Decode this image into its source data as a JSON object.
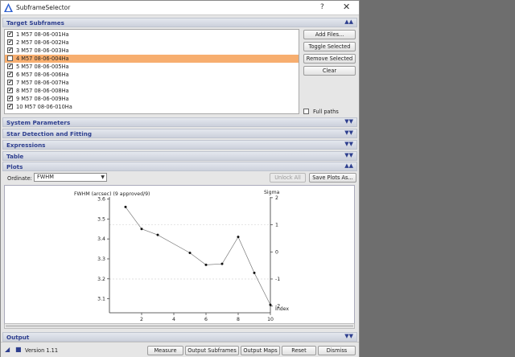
{
  "window": {
    "title": "SubframeSelector",
    "help": "?",
    "close": "✕"
  },
  "sections": {
    "target": "Target Subframes",
    "system": "System Parameters",
    "star": "Star Detection and Fitting",
    "expressions": "Expressions",
    "table": "Table",
    "plots": "Plots",
    "output": "Output"
  },
  "subframes": [
    {
      "label": "1 M57 08-06-001Ha",
      "checked": true,
      "selected": false
    },
    {
      "label": "2 M57 08-06-002Ha",
      "checked": true,
      "selected": false
    },
    {
      "label": "3 M57 08-06-003Ha",
      "checked": true,
      "selected": false
    },
    {
      "label": "4 M57 08-06-004Ha",
      "checked": false,
      "selected": true
    },
    {
      "label": "5 M57 08-06-005Ha",
      "checked": true,
      "selected": false
    },
    {
      "label": "6 M57 08-06-006Ha",
      "checked": true,
      "selected": false
    },
    {
      "label": "7 M57 08-06-007Ha",
      "checked": true,
      "selected": false
    },
    {
      "label": "8 M57 08-06-008Ha",
      "checked": true,
      "selected": false
    },
    {
      "label": "9 M57 08-06-009Ha",
      "checked": true,
      "selected": false
    },
    {
      "label": "10 M57 08-06-010Ha",
      "checked": true,
      "selected": false
    }
  ],
  "buttons": {
    "add_files": "Add Files...",
    "toggle_selected": "Toggle Selected",
    "remove_selected": "Remove Selected",
    "clear": "Clear",
    "unlock_all": "Unlock All",
    "save_plots": "Save Plots As...",
    "measure": "Measure",
    "output_subframes": "Output Subframes",
    "output_maps": "Output Maps",
    "reset": "Reset",
    "dismiss": "Dismiss"
  },
  "full_paths": {
    "label": "Full paths",
    "checked": false
  },
  "ordinate": {
    "label": "Ordinate:",
    "value": "FWHM"
  },
  "version": "Version 1.11",
  "chart_data": {
    "type": "line",
    "title": "FWHM (arcsec) (9 approved/9)",
    "ylabel_right": "Sigma",
    "xlabel": "Index",
    "x": [
      1,
      2,
      3,
      5,
      6,
      7,
      8,
      9,
      10
    ],
    "y": [
      3.56,
      3.45,
      3.42,
      3.33,
      3.27,
      3.275,
      3.41,
      3.23,
      3.07
    ],
    "xlim": [
      0,
      10
    ],
    "ylim": [
      3.03,
      3.61
    ],
    "xticks": [
      "2",
      "4",
      "6",
      "8",
      "10"
    ],
    "yticks": [
      "3.6",
      "3.5",
      "3.4",
      "3.3",
      "3.2",
      "3.1"
    ],
    "sigma_ticks": [
      "2",
      "1",
      "0",
      "-1",
      "-2"
    ],
    "colors": {
      "line": "#7a7a7a",
      "point": "#111111",
      "ref_line": "#d8d8d8"
    }
  }
}
